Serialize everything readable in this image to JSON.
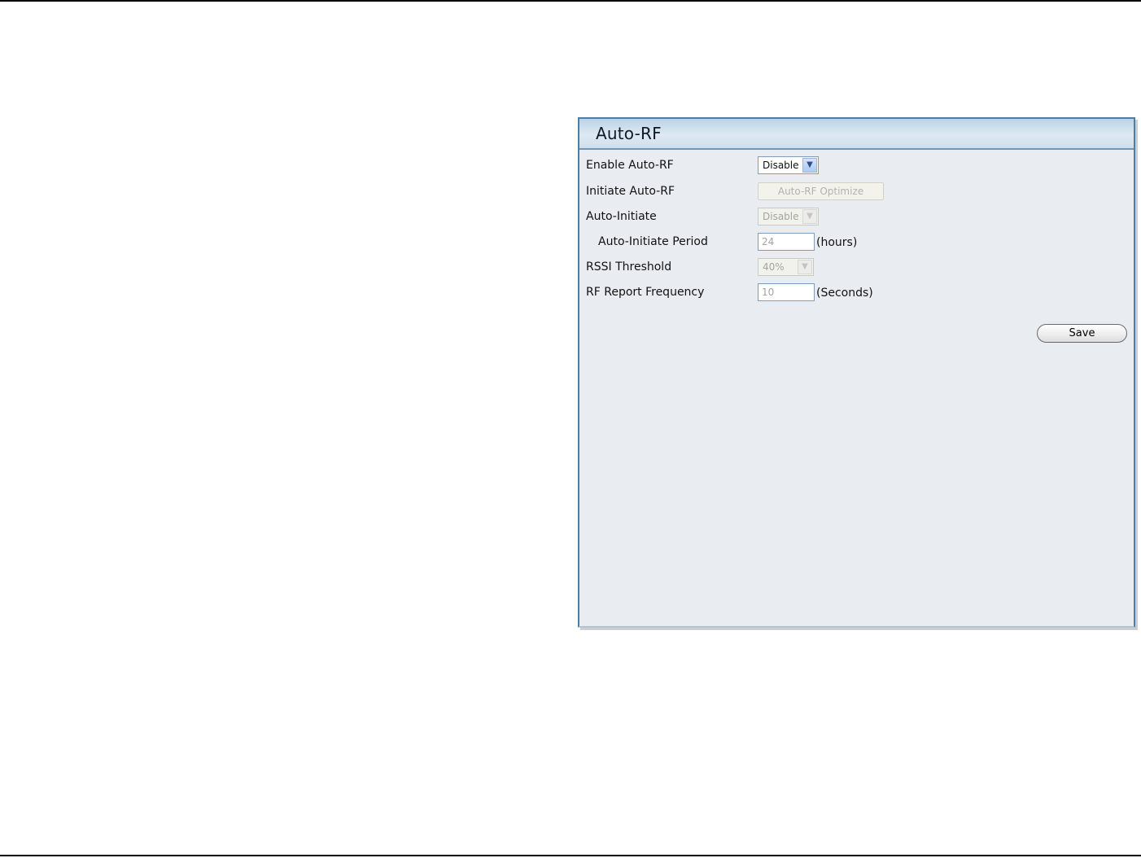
{
  "panel": {
    "title": "Auto-RF"
  },
  "fields": {
    "enable_auto_rf": {
      "label": "Enable Auto-RF",
      "value": "Disable"
    },
    "initiate_auto_rf": {
      "label": "Initiate Auto-RF",
      "button_label": "Auto-RF Optimize"
    },
    "auto_initiate": {
      "label": "Auto-Initiate",
      "value": "Disable"
    },
    "auto_initiate_period": {
      "label": "Auto-Initiate Period",
      "value": "24",
      "unit": "(hours)"
    },
    "rssi_threshold": {
      "label": "RSSI Threshold",
      "value": "40%"
    },
    "rf_report_frequency": {
      "label": "RF Report Frequency",
      "value": "10",
      "unit": "(Seconds)"
    }
  },
  "actions": {
    "save_label": "Save"
  },
  "icons": {
    "dropdown": "chevron-down-icon"
  },
  "colors": {
    "panel_border": "#4d7ea8",
    "panel_background": "#e9edf1",
    "header_gradient_top": "#bcd3e7"
  }
}
